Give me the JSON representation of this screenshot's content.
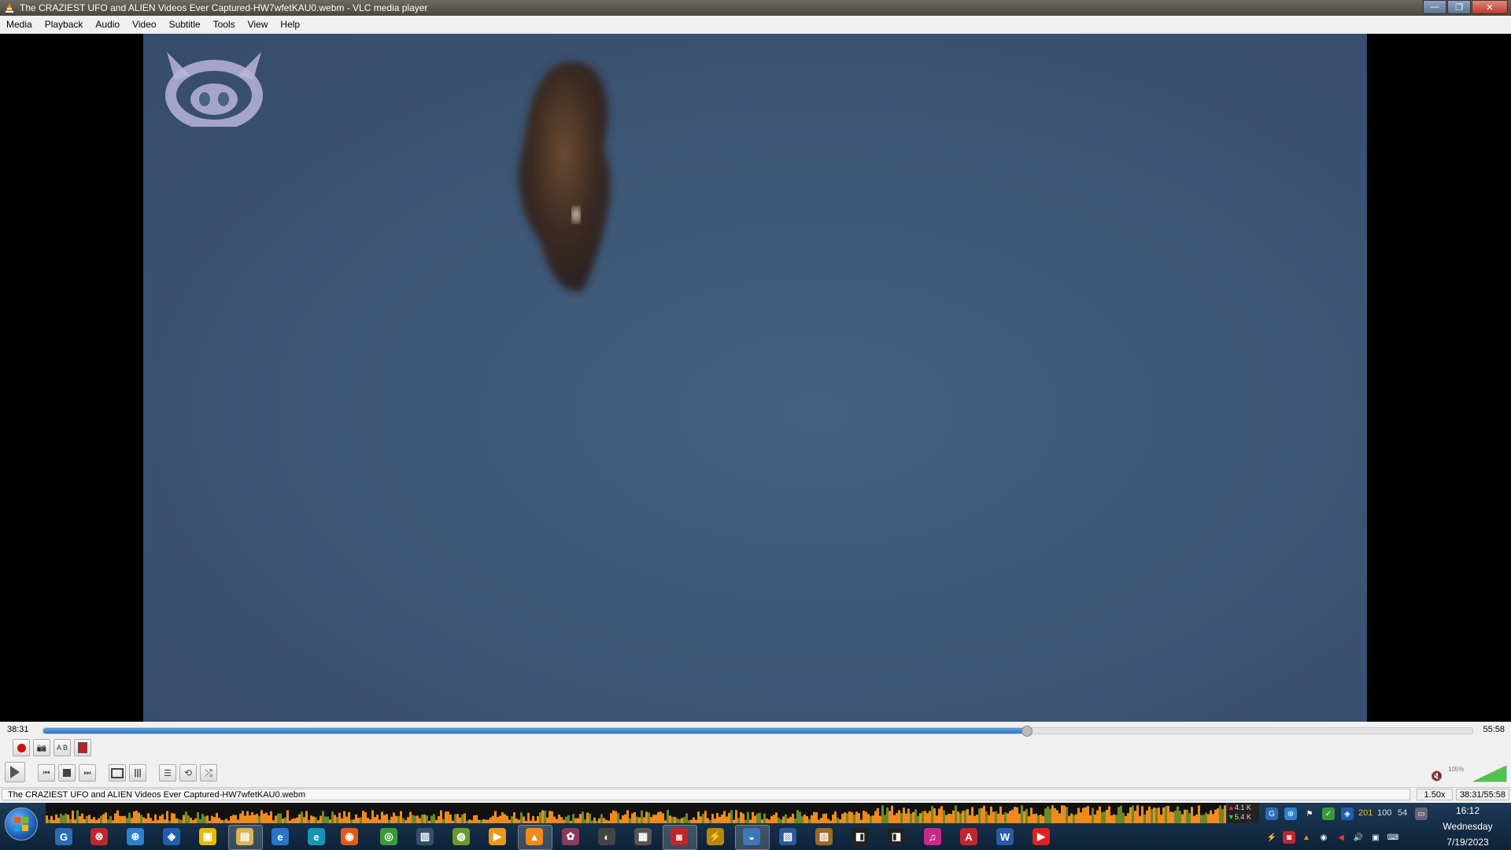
{
  "window": {
    "title": "The CRAZIEST UFO and ALIEN Videos Ever Captured-HW7wfetKAU0.webm - VLC media player",
    "minimize": "—",
    "maximize": "❐",
    "close": "✕"
  },
  "menu": [
    "Media",
    "Playback",
    "Audio",
    "Video",
    "Subtitle",
    "Tools",
    "View",
    "Help"
  ],
  "player": {
    "elapsed": "38:31",
    "duration": "55:58",
    "progress_fraction": 0.688,
    "volume_label": "105%",
    "volume_fraction": 1.0
  },
  "status": {
    "file": "The CRAZIEST UFO and ALIEN Videos Ever Captured-HW7wfetKAU0.webm",
    "rate": "1.50x",
    "time": "38:31/55:58"
  },
  "netmeter": {
    "up": "4.1 K",
    "down": "5.4 K"
  },
  "tray": {
    "n1": "201",
    "n2": "100",
    "n3": "54"
  },
  "clock": {
    "time": "16:12",
    "day": "Wednesday",
    "date": "7/19/2023"
  },
  "colors": {
    "seek_fill": "#2f78c8",
    "taskbar": "#1d3a57",
    "video_bg": "#3e5877"
  }
}
